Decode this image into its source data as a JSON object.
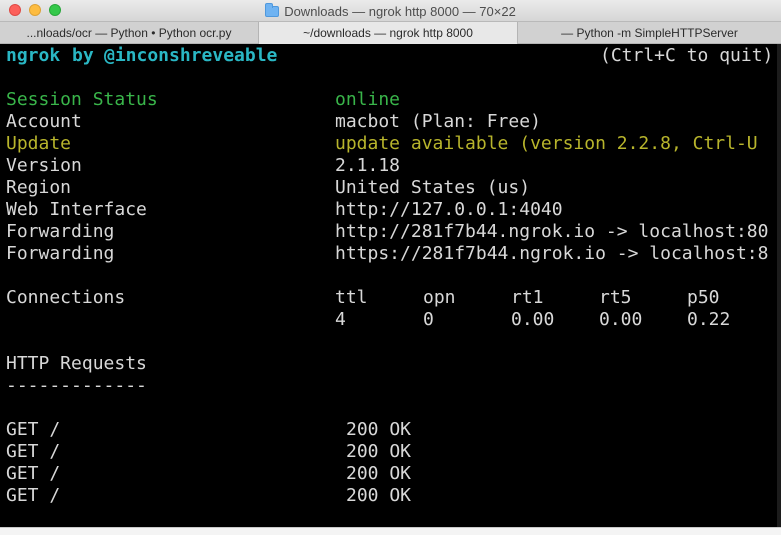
{
  "window": {
    "title": "Downloads — ngrok http 8000 — 70×22",
    "tabs": [
      "...nloads/ocr — Python • Python ocr.py",
      "~/downloads — ngrok http 8000",
      "— Python -m SimpleHTTPServer"
    ]
  },
  "terminal": {
    "header_left_1": "ngrok",
    "header_left_2": "by",
    "header_left_3": "@inconshreveable",
    "header_right": "(Ctrl+C to quit)",
    "status_rows": [
      {
        "label": "Session Status",
        "value": "online"
      },
      {
        "label": "Account",
        "value": "macbot (Plan: Free)"
      },
      {
        "label": "Update",
        "value": "update available (version 2.2.8, Ctrl-U"
      },
      {
        "label": "Version",
        "value": "2.1.18"
      },
      {
        "label": "Region",
        "value": "United States (us)"
      },
      {
        "label": "Web Interface",
        "value": "http://127.0.0.1:4040"
      },
      {
        "label": "Forwarding",
        "value": "http://281f7b44.ngrok.io -> localhost:80"
      },
      {
        "label": "Forwarding",
        "value": "https://281f7b44.ngrok.io -> localhost:8"
      }
    ],
    "connections": {
      "label": "Connections",
      "headers": [
        "ttl",
        "opn",
        "rt1",
        "rt5",
        "p50"
      ],
      "values": [
        "4",
        "0",
        "0.00",
        "0.00",
        "0.22"
      ]
    },
    "http_requests": {
      "title": "HTTP Requests",
      "underline": "-------------",
      "rows": [
        {
          "method": "GET /",
          "status": "200 OK"
        },
        {
          "method": "GET /",
          "status": "200 OK"
        },
        {
          "method": "GET /",
          "status": "200 OK"
        },
        {
          "method": "GET /",
          "status": "200 OK"
        }
      ]
    }
  }
}
